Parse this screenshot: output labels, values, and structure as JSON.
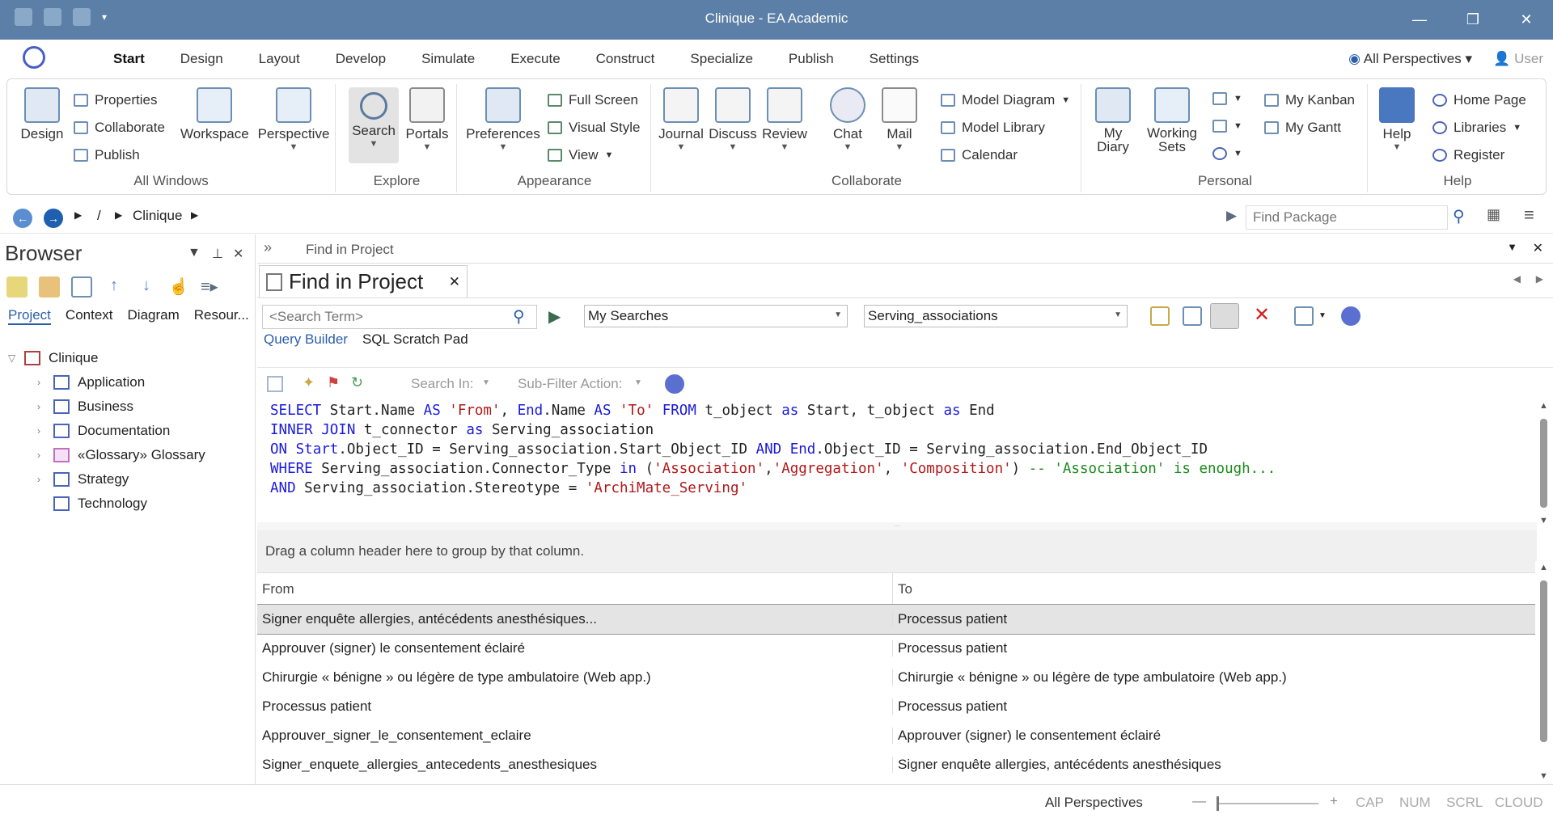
{
  "window": {
    "title": "Clinique - EA Academic"
  },
  "menu": {
    "tabs": [
      "Start",
      "Design",
      "Layout",
      "Develop",
      "Simulate",
      "Execute",
      "Construct",
      "Specialize",
      "Publish",
      "Settings"
    ],
    "active": "Start",
    "perspectives_label": "All Perspectives",
    "user_label": "User"
  },
  "ribbon": {
    "all_windows": {
      "label": "All Windows",
      "design": "Design",
      "properties": "Properties",
      "collaborate": "Collaborate",
      "publish": "Publish",
      "workspace": "Workspace",
      "perspective": "Perspective"
    },
    "explore": {
      "label": "Explore",
      "search": "Search",
      "portals": "Portals"
    },
    "appearance": {
      "label": "Appearance",
      "preferences": "Preferences",
      "full_screen": "Full Screen",
      "visual_style": "Visual Style",
      "view": "View"
    },
    "collaborate": {
      "label": "Collaborate",
      "journal": "Journal",
      "discuss": "Discuss",
      "review": "Review",
      "chat": "Chat",
      "mail": "Mail",
      "model_diagram": "Model Diagram",
      "model_library": "Model Library",
      "calendar": "Calendar"
    },
    "personal": {
      "label": "Personal",
      "my_diary_1": "My",
      "my_diary_2": "Diary",
      "working_sets_1": "Working",
      "working_sets_2": "Sets",
      "my_kanban": "My Kanban",
      "my_gantt": "My Gantt"
    },
    "help": {
      "label": "Help",
      "help": "Help",
      "home_page": "Home Page",
      "libraries": "Libraries",
      "register": "Register"
    }
  },
  "nav": {
    "crumb_root": "/",
    "crumb_item": "Clinique",
    "find_package_placeholder": "Find Package"
  },
  "browser": {
    "title": "Browser",
    "tabs": [
      "Project",
      "Context",
      "Diagram",
      "Resour..."
    ],
    "root": "Clinique",
    "items": [
      "Application",
      "Business",
      "Documentation",
      "«Glossary» Glossary",
      "Strategy",
      "Technology"
    ]
  },
  "find": {
    "header": "Find in Project",
    "tab_title": "Find in Project",
    "search_placeholder": "<Search Term>",
    "my_searches": "My Searches",
    "search_name": "Serving_associations",
    "subtabs": [
      "Query Builder",
      "SQL Scratch Pad"
    ],
    "search_in": "Search In:",
    "sub_filter": "Sub-Filter Action:",
    "group_hint": "Drag a column header here to group by that column.",
    "columns": [
      "From",
      "To"
    ],
    "rows": [
      [
        "Signer enquête allergies, antécédents anesthésiques...",
        "Processus patient"
      ],
      [
        "Approuver (signer) le consentement éclairé",
        "Processus patient"
      ],
      [
        "Chirurgie « bénigne » ou légère de type ambulatoire (Web app.)",
        "Chirurgie « bénigne » ou légère de type ambulatoire (Web app.)"
      ],
      [
        "Processus patient",
        "Processus patient"
      ],
      [
        "Approuver_signer_le_consentement_eclaire",
        "Approuver (signer) le consentement éclairé"
      ],
      [
        "Signer_enquete_allergies_antecedents_anesthesiques",
        "Signer enquête allergies, antécédents anesthésiques"
      ]
    ]
  },
  "sql": {
    "l1": {
      "a": "SELECT",
      "b": " Start.Name ",
      "c": "AS",
      "d": " ",
      "e": "'From'",
      "f": ", ",
      "g": "End",
      "h": ".Name ",
      "i": "AS",
      "j": " ",
      "k": "'To'",
      "l": " ",
      "m": "FROM",
      "n": " t_object ",
      "o": "as",
      "p": " Start, t_object ",
      "q": "as",
      "r": " End"
    },
    "l2": {
      "a": "INNER JOIN",
      "b": " t_connector ",
      "c": "as",
      "d": " Serving_association"
    },
    "l3": {
      "a": "ON",
      "b": " ",
      "c": "Start",
      "d": ".Object_ID = Serving_association.Start_Object_ID ",
      "e": "AND",
      "f": " ",
      "g": "End",
      "h": ".Object_ID = Serving_association.End_Object_ID"
    },
    "l4": {
      "a": "WHERE",
      "b": " Serving_association.Connector_Type ",
      "c": "in",
      "d": " (",
      "e": "'Association'",
      "f": ",",
      "g": "'Aggregation'",
      "h": ", ",
      "i": "'Composition'",
      "j": ") ",
      "k": "-- 'Association' is enough..."
    },
    "l5": {
      "a": "AND",
      "b": " Serving_association.Stereotype = ",
      "c": "'ArchiMate_Serving'"
    }
  },
  "status": {
    "perspectives": "All Perspectives",
    "cap": "CAP",
    "num": "NUM",
    "scrl": "SCRL",
    "cloud": "CLOUD"
  },
  "colors": {
    "titlebar": "#5b7fa6",
    "accent": "#2b5ea8",
    "keyword": "#1a1adb",
    "string": "#b01818",
    "comment": "#1c8a1c"
  }
}
